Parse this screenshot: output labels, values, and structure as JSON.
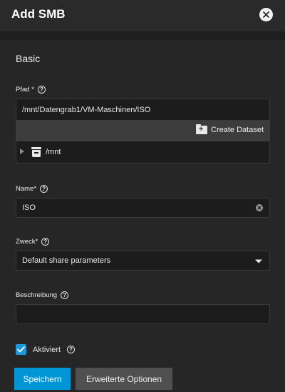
{
  "header": {
    "title": "Add SMB"
  },
  "section": {
    "title": "Basic"
  },
  "path_field": {
    "label": "Pfad",
    "required": "*",
    "value": "/mnt/Datengrab1/VM-Maschinen/ISO",
    "create_dataset_label": "Create Dataset",
    "tree_root": "/mnt"
  },
  "name_field": {
    "label": "Name",
    "required": "*",
    "value": "ISO"
  },
  "purpose_field": {
    "label": "Zweck",
    "required": "*",
    "value": "Default share parameters"
  },
  "description_field": {
    "label": "Beschreibung",
    "value": ""
  },
  "enabled": {
    "label": "Aktiviert",
    "checked": true
  },
  "buttons": {
    "save": "Speichern",
    "advanced": "Erweiterte Optionen"
  },
  "icons": {
    "close": "close-circle-icon",
    "help": "help-circle-icon",
    "folder": "folder-plus-icon",
    "server": "server-icon",
    "clear": "clear-circle-icon",
    "dropdown": "chevron-down-icon",
    "check": "check-icon"
  },
  "colors": {
    "accent": "#0095d5",
    "checkbox": "#1c97d8",
    "background": "#1e1e1e",
    "card": "#262626"
  }
}
